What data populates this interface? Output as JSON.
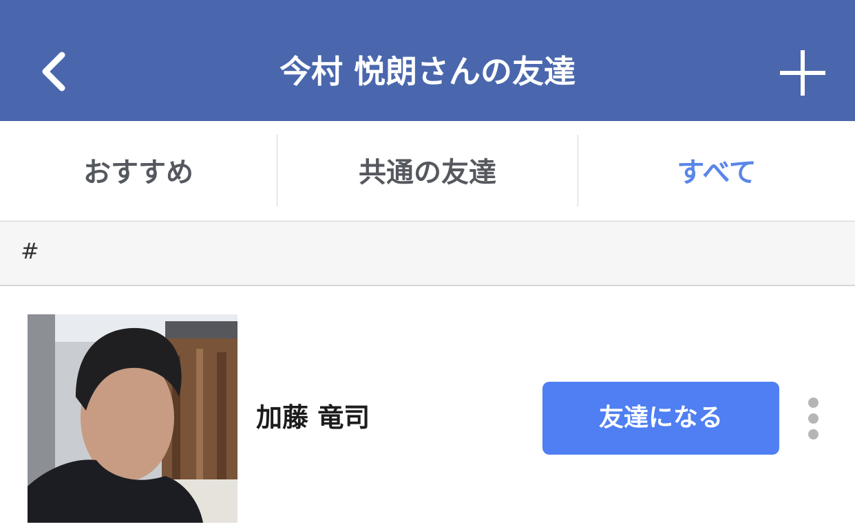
{
  "header": {
    "title": "今村 悦朗さんの友達",
    "background": "#4a67ad",
    "back_icon": "chevron-left-icon",
    "add_icon": "plus-icon"
  },
  "tabs": [
    {
      "label": "おすすめ",
      "active": false
    },
    {
      "label": "共通の友達",
      "active": false
    },
    {
      "label": "すべて",
      "active": true
    }
  ],
  "tab_active_color": "#5a86e8",
  "section": {
    "label": "#"
  },
  "friends": [
    {
      "name": "加藤 竜司",
      "action_label": "友達になる",
      "action_color": "#4f7ff2",
      "more_icon": "more-vertical-icon"
    }
  ]
}
